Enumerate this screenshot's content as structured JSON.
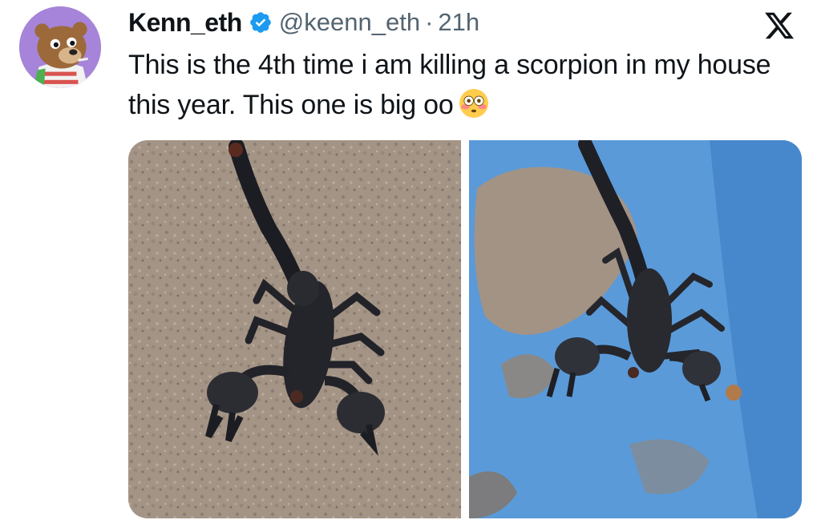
{
  "tweet": {
    "author": {
      "display_name": "Kenn_eth",
      "handle": "@keenn_eth",
      "verified": true,
      "avatar": "cartoon-bear-avatar"
    },
    "separator": "·",
    "timestamp": "21h",
    "text": "This is the 4th time i am killing a scorpion in my house this year. This one is big oo",
    "emoji": "flushed-face-emoji",
    "media": [
      {
        "description_icon": "scorpion-photo",
        "background": "concrete-ground"
      },
      {
        "description_icon": "scorpion-photo",
        "background": "blue-plastic-basin"
      }
    ]
  },
  "platform_logo": "x-logo",
  "colors": {
    "text_primary": "#0f1419",
    "text_secondary": "#536471",
    "verified_blue": "#1d9bf0",
    "avatar_bg": "#a684d9"
  }
}
